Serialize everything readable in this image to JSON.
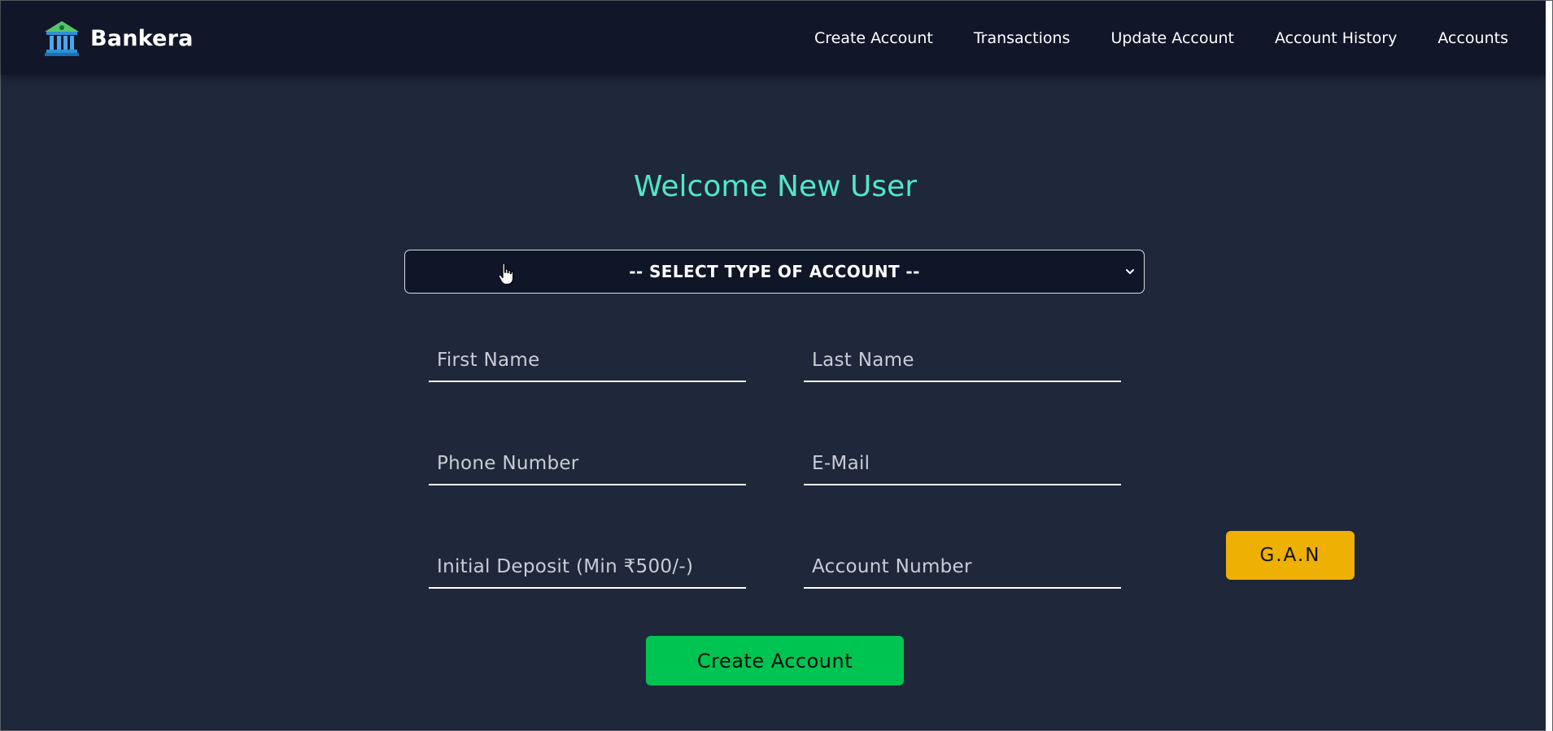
{
  "navbar": {
    "brand_name": "Bankera",
    "brand_icon": "bank-building-icon",
    "links": [
      {
        "label": "Create Account"
      },
      {
        "label": "Transactions"
      },
      {
        "label": "Update Account"
      },
      {
        "label": "Account History"
      },
      {
        "label": "Accounts"
      }
    ]
  },
  "form": {
    "title": "Welcome New User",
    "account_type_select": {
      "selected": "-- SELECT TYPE OF ACCOUNT --",
      "icon": "chevron-down-icon"
    },
    "fields": {
      "first_name": "First Name",
      "last_name": "Last Name",
      "phone": "Phone Number",
      "email": "E-Mail",
      "initial_deposit": "Initial Deposit (Min ₹500/-)",
      "account_number": "Account Number"
    },
    "gan_button": "G.A.N",
    "create_button": "Create Account"
  },
  "colors": {
    "background": "#1f273b",
    "navbar": "#111729",
    "title": "#4fe8c6",
    "gan_button": "#eeb003",
    "create_button": "#00c451"
  }
}
